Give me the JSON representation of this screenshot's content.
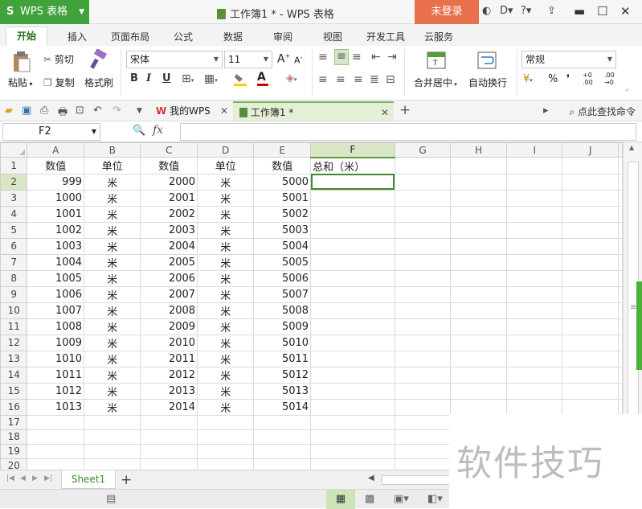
{
  "app": {
    "logo": "S",
    "name": "WPS 表格",
    "doc_title": "工作簿1 * - WPS 表格",
    "login": "未登录"
  },
  "menu_tabs": [
    "开始",
    "插入",
    "页面布局",
    "公式",
    "数据",
    "审阅",
    "视图",
    "开发工具",
    "云服务"
  ],
  "ribbon": {
    "paste": "粘贴",
    "cut": "剪切",
    "copy": "复制",
    "format_painter": "格式刷",
    "font_name": "宋体",
    "font_size": "11",
    "bold": "B",
    "italic": "I",
    "underline": "U",
    "merge_center": "合并居中",
    "wrap": "自动换行",
    "number_format": "常规",
    "percent": "%",
    "comma": "❜"
  },
  "quickbar": {
    "tab_mywps": "我的WPS",
    "tab_book": "工作簿1 *",
    "search_cmd": "点此查找命令"
  },
  "formula_bar": {
    "cell_ref": "F2",
    "fx": "fx",
    "formula": ""
  },
  "sheet": {
    "columns": [
      "A",
      "B",
      "C",
      "D",
      "E",
      "F",
      "G",
      "H",
      "I",
      "J"
    ],
    "selected_col": "F",
    "selected_row": 2,
    "rows": [
      [
        "数值",
        "单位",
        "数值",
        "单位",
        "数值",
        "总和（米）",
        "",
        "",
        "",
        ""
      ],
      [
        "999",
        "米",
        "2000",
        "米",
        "5000",
        "",
        "",
        "",
        "",
        ""
      ],
      [
        "1000",
        "米",
        "2001",
        "米",
        "5001",
        "",
        "",
        "",
        "",
        ""
      ],
      [
        "1001",
        "米",
        "2002",
        "米",
        "5002",
        "",
        "",
        "",
        "",
        ""
      ],
      [
        "1002",
        "米",
        "2003",
        "米",
        "5003",
        "",
        "",
        "",
        "",
        ""
      ],
      [
        "1003",
        "米",
        "2004",
        "米",
        "5004",
        "",
        "",
        "",
        "",
        ""
      ],
      [
        "1004",
        "米",
        "2005",
        "米",
        "5005",
        "",
        "",
        "",
        "",
        ""
      ],
      [
        "1005",
        "米",
        "2006",
        "米",
        "5006",
        "",
        "",
        "",
        "",
        ""
      ],
      [
        "1006",
        "米",
        "2007",
        "米",
        "5007",
        "",
        "",
        "",
        "",
        ""
      ],
      [
        "1007",
        "米",
        "2008",
        "米",
        "5008",
        "",
        "",
        "",
        "",
        ""
      ],
      [
        "1008",
        "米",
        "2009",
        "米",
        "5009",
        "",
        "",
        "",
        "",
        ""
      ],
      [
        "1009",
        "米",
        "2010",
        "米",
        "5010",
        "",
        "",
        "",
        "",
        ""
      ],
      [
        "1010",
        "米",
        "2011",
        "米",
        "5011",
        "",
        "",
        "",
        "",
        ""
      ],
      [
        "1011",
        "米",
        "2012",
        "米",
        "5012",
        "",
        "",
        "",
        "",
        ""
      ],
      [
        "1012",
        "米",
        "2013",
        "米",
        "5013",
        "",
        "",
        "",
        "",
        ""
      ],
      [
        "1013",
        "米",
        "2014",
        "米",
        "5014",
        "",
        "",
        "",
        "",
        ""
      ],
      [
        "",
        "",
        "",
        "",
        "",
        "",
        "",
        "",
        "",
        ""
      ],
      [
        "",
        "",
        "",
        "",
        "",
        "",
        "",
        "",
        "",
        ""
      ],
      [
        "",
        "",
        "",
        "",
        "",
        "",
        "",
        "",
        "",
        ""
      ],
      [
        "",
        "",
        "",
        "",
        "",
        "",
        "",
        "",
        "",
        ""
      ],
      [
        "",
        "",
        "",
        "",
        "",
        "",
        "",
        "",
        "",
        ""
      ],
      [
        "",
        "",
        "",
        "",
        "",
        "",
        "",
        "",
        "",
        ""
      ]
    ]
  },
  "sheet_tabs": [
    "Sheet1"
  ],
  "watermark": "软件技巧",
  "colors": {
    "accent_green": "#3fa23a",
    "login_orange": "#e8704c",
    "selection_green": "#3f8a2a"
  }
}
